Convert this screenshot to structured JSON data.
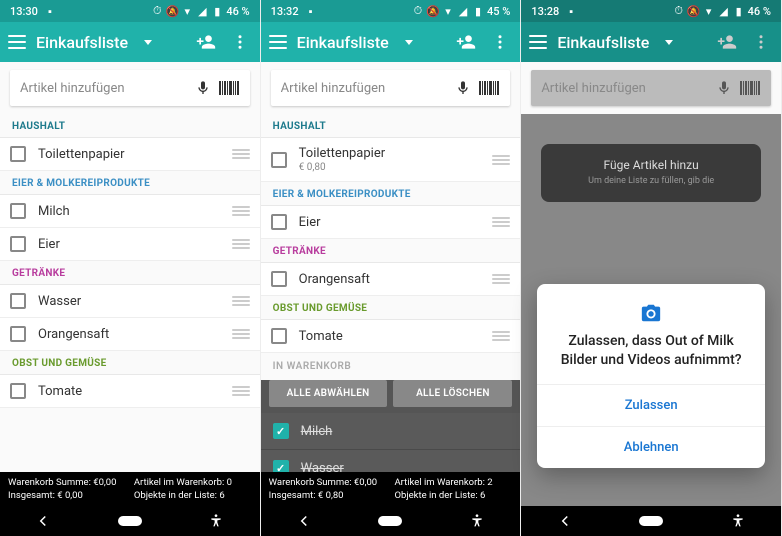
{
  "screens": [
    {
      "status": {
        "time": "13:30",
        "battery": "46 %"
      },
      "appbar": {
        "title": "Einkaufsliste"
      },
      "search": {
        "placeholder": "Artikel hinzufügen"
      },
      "categories": [
        {
          "name": "HAUSHALT",
          "cls": "cat-haushalt",
          "items": [
            {
              "label": "Toilettenpapier"
            }
          ]
        },
        {
          "name": "EIER & MOLKEREIPRODUKTE",
          "cls": "cat-eier",
          "items": [
            {
              "label": "Milch"
            },
            {
              "label": "Eier"
            }
          ]
        },
        {
          "name": "GETRÄNKE",
          "cls": "cat-getranke",
          "items": [
            {
              "label": "Wasser"
            },
            {
              "label": "Orangensaft"
            }
          ]
        },
        {
          "name": "OBST UND GEMÜSE",
          "cls": "cat-obst",
          "items": [
            {
              "label": "Tomate"
            }
          ]
        }
      ],
      "summary": {
        "tl": "Warenkorb Summe: €0,00",
        "tr": "Artikel im Warenkorb: 0",
        "bl": "Insgesamt: € 0,00",
        "br": "Objekte in der Liste: 6"
      }
    },
    {
      "status": {
        "time": "13:32",
        "battery": "45 %"
      },
      "appbar": {
        "title": "Einkaufsliste"
      },
      "search": {
        "placeholder": "Artikel hinzufügen"
      },
      "categories": [
        {
          "name": "HAUSHALT",
          "cls": "cat-haushalt",
          "items": [
            {
              "label": "Toilettenpapier",
              "sub": "€ 0,80"
            }
          ]
        },
        {
          "name": "EIER & MOLKEREIPRODUKTE",
          "cls": "cat-eier",
          "items": [
            {
              "label": "Eier"
            }
          ]
        },
        {
          "name": "GETRÄNKE",
          "cls": "cat-getranke",
          "items": [
            {
              "label": "Orangensaft"
            }
          ]
        },
        {
          "name": "OBST UND GEMÜSE",
          "cls": "cat-obst",
          "items": [
            {
              "label": "Tomate"
            }
          ]
        }
      ],
      "cart": {
        "label": "IN WARENKORB",
        "deselect": "ALLE ABWÄHLEN",
        "delete": "ALLE LÖSCHEN",
        "items": [
          {
            "label": "Milch"
          },
          {
            "label": "Wasser"
          }
        ]
      },
      "summary": {
        "tl": "Warenkorb Summe: €0,00",
        "tr": "Artikel im Warenkorb: 2",
        "bl": "Insgesamt: € 0,80",
        "br": "Objekte in der Liste: 6"
      }
    },
    {
      "status": {
        "time": "13:28",
        "battery": "46 %"
      },
      "appbar": {
        "title": "Einkaufsliste"
      },
      "search": {
        "placeholder": "Artikel hinzufügen"
      },
      "onboard": {
        "title": "Füge Artikel hinzu",
        "sub": "Um deine Liste zu füllen, gib die"
      },
      "dialog": {
        "text": "Zulassen, dass Out of Milk Bilder und Videos aufnimmt?",
        "allow": "Zulassen",
        "deny": "Ablehnen"
      }
    }
  ]
}
